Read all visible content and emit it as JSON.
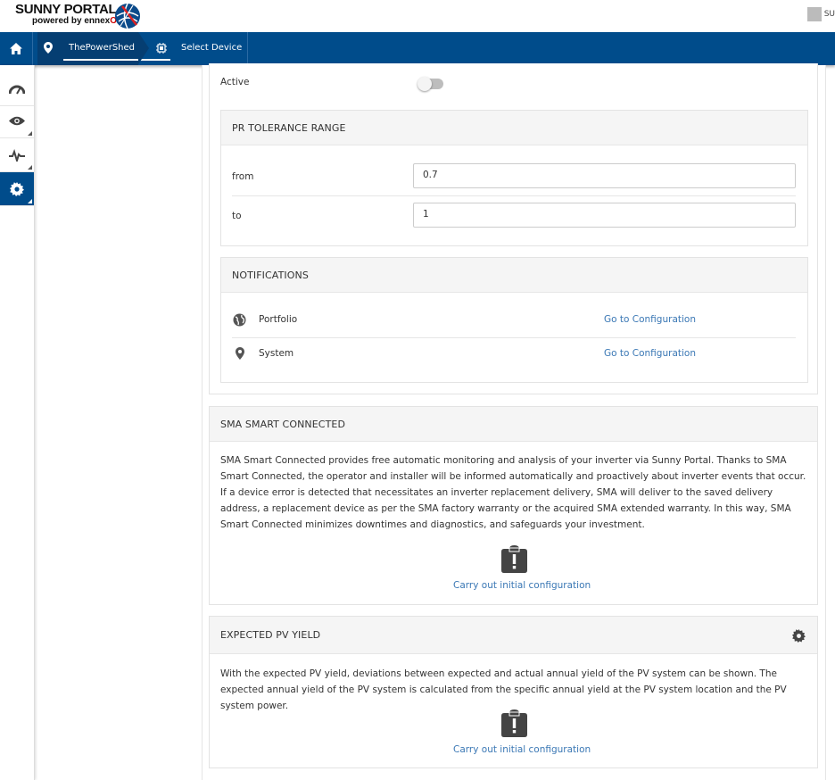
{
  "brand": {
    "title": "SUNNY PORTAL",
    "sub_prefix": "powered by ennex",
    "sub_suffix": "OS"
  },
  "user": {
    "label": "SU"
  },
  "nav": {
    "crumb_plant": "ThePowerShed",
    "crumb_device": "Select Device"
  },
  "sidebar": {
    "items": [
      {
        "name": "dashboard-icon"
      },
      {
        "name": "eye-icon"
      },
      {
        "name": "pulse-icon"
      },
      {
        "name": "gear-icon",
        "active": true
      }
    ]
  },
  "active": {
    "label": "Active",
    "on": false
  },
  "pr_tolerance": {
    "title": "PR TOLERANCE RANGE",
    "from_label": "from",
    "from_value": "0.7",
    "to_label": "to",
    "to_value": "1"
  },
  "notifications": {
    "title": "NOTIFICATIONS",
    "rows": [
      {
        "label": "Portfolio",
        "icon": "globe-icon",
        "link": "Go to Configuration"
      },
      {
        "label": "System",
        "icon": "location-pin-icon",
        "link": "Go to Configuration"
      }
    ]
  },
  "smart_connected": {
    "title": "SMA SMART CONNECTED",
    "text": "SMA Smart Connected provides free automatic monitoring and analysis of your inverter via Sunny Portal. Thanks to SMA Smart Connected, the operator and installer will be informed automatically and proactively about inverter events that occur. If a device error is detected that necessitates an inverter replacement delivery, SMA will deliver to the saved delivery address, a replacement device as per the SMA factory warranty or the acquired SMA extended warranty. In this way, SMA Smart Connected minimizes downtimes and diagnostics, and safeguards your investment.",
    "action": "Carry out initial configuration"
  },
  "expected_yield": {
    "title": "EXPECTED PV YIELD",
    "text": "With the expected PV yield, deviations between expected and actual annual yield of the PV system can be shown. The expected annual yield of the PV system is calculated from the specific annual yield at the PV system location and the PV system power.",
    "action": "Carry out initial configuration"
  },
  "colors": {
    "navbar": "#004c8b",
    "link": "#3b78b5",
    "accent_red": "#cc0000"
  }
}
